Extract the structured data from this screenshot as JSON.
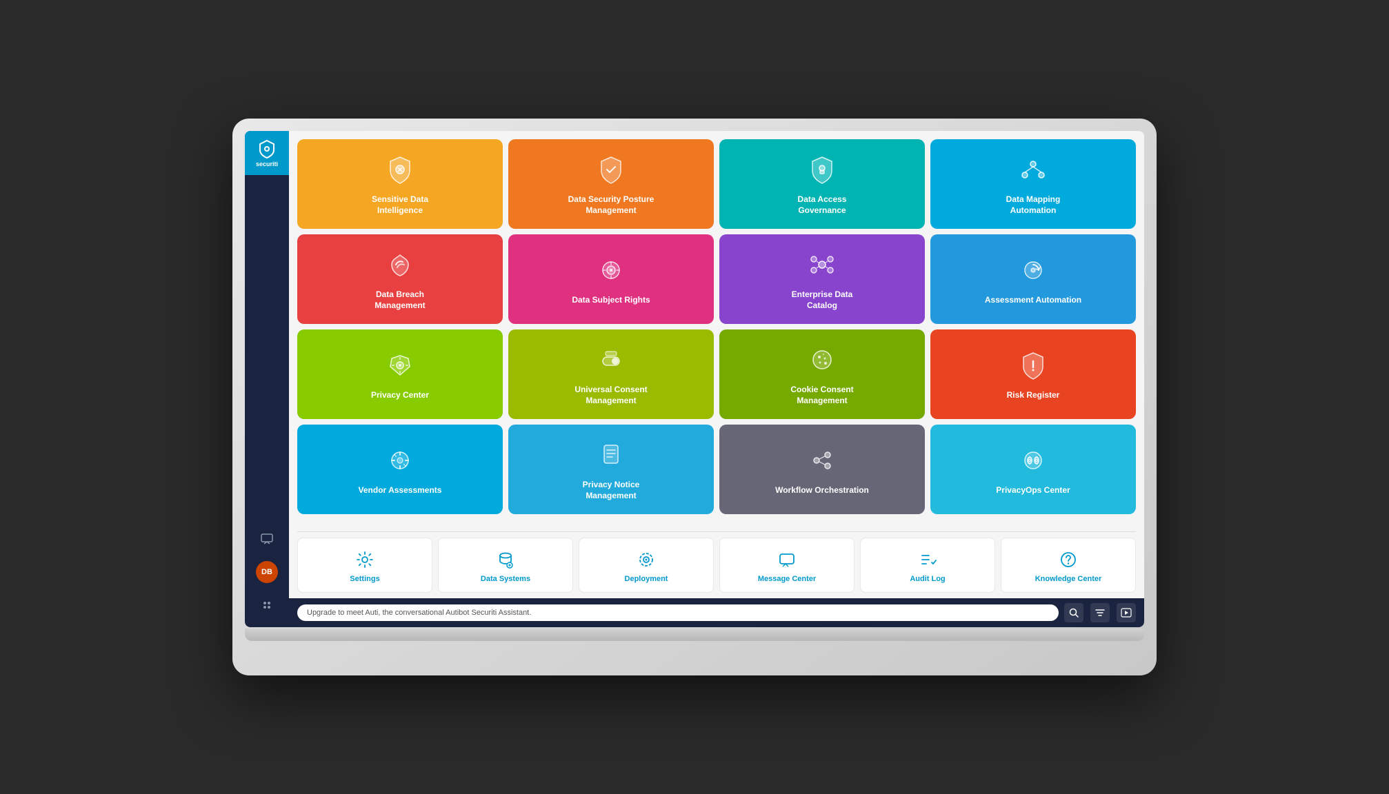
{
  "app": {
    "name": "securiti",
    "logo_text": "securiti"
  },
  "sidebar": {
    "avatar_initials": "DB",
    "avatar_color": "#cc4400"
  },
  "tiles": {
    "row1": [
      {
        "label": "Sensitive Data\nIntelligence",
        "color": "tile-yellow",
        "icon": "shield-gear"
      },
      {
        "label": "Data Security Posture\nManagement",
        "color": "tile-orange",
        "icon": "shield-check"
      },
      {
        "label": "Data Access\nGovernance",
        "color": "tile-teal",
        "icon": "shield-lock"
      },
      {
        "label": "Data Mapping\nAutomation",
        "color": "tile-blue-light",
        "icon": "share"
      }
    ],
    "row2": [
      {
        "label": "Data Breach\nManagement",
        "color": "tile-red",
        "icon": "wifi-alert"
      },
      {
        "label": "Data Subject Rights",
        "color": "tile-pink",
        "icon": "target-circle"
      },
      {
        "label": "Enterprise Data\nCatalog",
        "color": "tile-purple",
        "icon": "nodes"
      },
      {
        "label": "Assessment Automation",
        "color": "tile-blue-med",
        "icon": "circle-arrow"
      }
    ],
    "row3": [
      {
        "label": "Privacy Center",
        "color": "tile-green-bright",
        "icon": "hexagon-gear"
      },
      {
        "label": "Universal Consent\nManagement",
        "color": "tile-olive",
        "icon": "toggle"
      },
      {
        "label": "Cookie Consent\nManagement",
        "color": "tile-green-dark",
        "icon": "cookie"
      },
      {
        "label": "Risk Register",
        "color": "tile-red-orange",
        "icon": "shield-exclaim"
      }
    ],
    "row4": [
      {
        "label": "Vendor Assessments",
        "color": "tile-cyan",
        "icon": "settings-dots"
      },
      {
        "label": "Privacy Notice\nManagement",
        "color": "tile-cyan2",
        "icon": "document-lines"
      },
      {
        "label": "Workflow Orchestration",
        "color": "tile-gray",
        "icon": "branch-nodes"
      },
      {
        "label": "PrivacyOps Center",
        "color": "tile-blue-bright",
        "icon": "eyes-circle"
      }
    ]
  },
  "bottom_tiles": [
    {
      "label": "Settings",
      "icon": "gear"
    },
    {
      "label": "Data Systems",
      "icon": "database-search"
    },
    {
      "label": "Deployment",
      "icon": "gear-dotted"
    },
    {
      "label": "Message Center",
      "icon": "chat-bubble"
    },
    {
      "label": "Audit Log",
      "icon": "list-check"
    },
    {
      "label": "Knowledge Center",
      "icon": "question-circle"
    }
  ],
  "status_bar": {
    "message": "Upgrade to meet Auti, the conversational Autibot Securiti Assistant."
  }
}
